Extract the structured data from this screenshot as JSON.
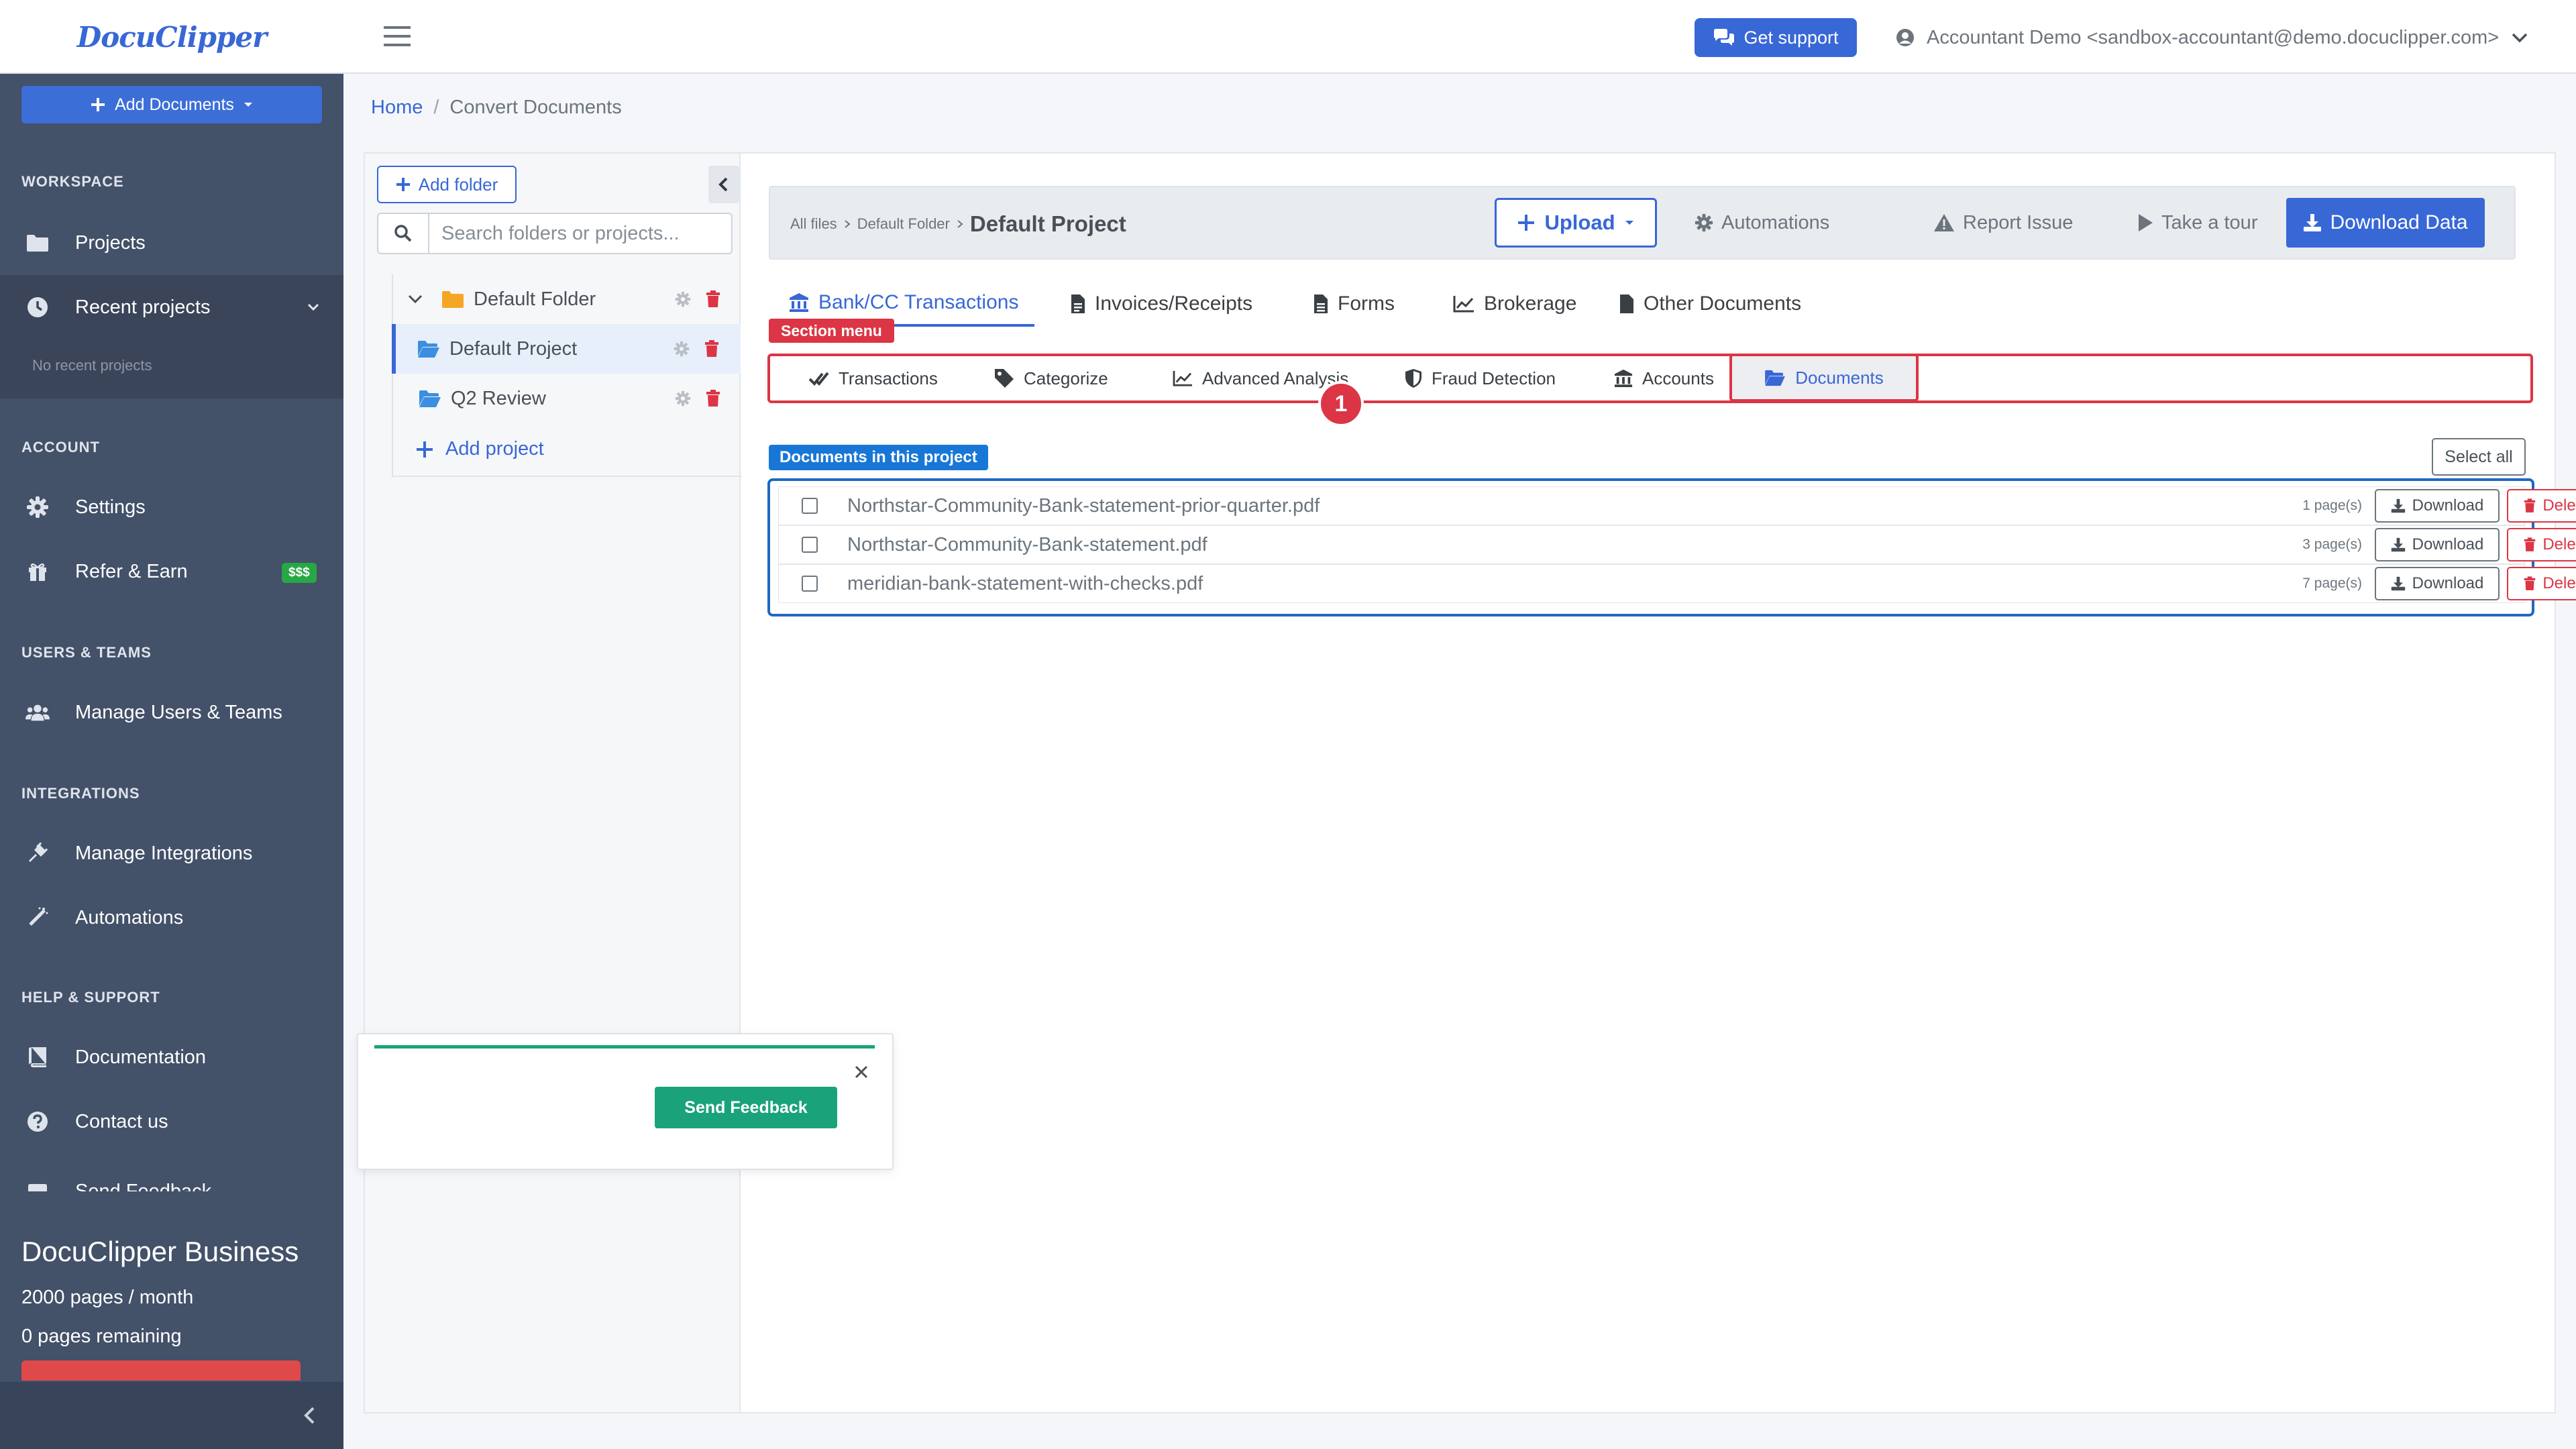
{
  "app": {
    "logo": "DocuClipper"
  },
  "topbar": {
    "support_label": "Get support",
    "user_label": "Accountant Demo <sandbox-accountant@demo.docuclipper.com>"
  },
  "sidebar": {
    "add_documents_label": "Add Documents",
    "sections": {
      "workspace": "WORKSPACE",
      "account": "ACCOUNT",
      "users": "USERS & TEAMS",
      "integrations": "INTEGRATIONS",
      "help": "HELP & SUPPORT"
    },
    "items": {
      "projects": "Projects",
      "recent_projects": "Recent projects",
      "no_recent": "No recent projects",
      "settings": "Settings",
      "refer": "Refer & Earn",
      "refer_badge": "$$$",
      "manage_users": "Manage Users & Teams",
      "manage_integrations": "Manage Integrations",
      "automations": "Automations",
      "documentation": "Documentation",
      "contact": "Contact us",
      "send_feedback": "Send Feedback"
    },
    "plan": {
      "name": "DocuClipper Business",
      "pages": "2000 pages / month",
      "remaining": "0 pages remaining"
    }
  },
  "breadcrumb": {
    "home": "Home",
    "separator": "/",
    "current": "Convert Documents"
  },
  "folders": {
    "add_folder_label": "Add folder",
    "search_placeholder": "Search folders or projects...",
    "tree": [
      {
        "label": "Default Folder",
        "type": "folder"
      },
      {
        "label": "Default Project",
        "type": "project",
        "selected": true
      },
      {
        "label": "Q2 Review",
        "type": "project"
      }
    ],
    "add_project_label": "Add project"
  },
  "project_header": {
    "crumb_all": "All files",
    "crumb_folder": "Default Folder",
    "project_name": "Default Project",
    "upload_label": "Upload",
    "automations_label": "Automations",
    "report_label": "Report Issue",
    "tour_label": "Take a tour",
    "download_data_label": "Download Data"
  },
  "category_tabs": [
    {
      "label": "Bank/CC Transactions",
      "active": true
    },
    {
      "label": "Invoices/Receipts"
    },
    {
      "label": "Forms"
    },
    {
      "label": "Brokerage"
    },
    {
      "label": "Other Documents"
    }
  ],
  "section_menu": {
    "label": "Section menu",
    "step_number": "1",
    "tabs": [
      {
        "label": "Transactions"
      },
      {
        "label": "Categorize"
      },
      {
        "label": "Advanced Analysis"
      },
      {
        "label": "Fraud Detection"
      },
      {
        "label": "Accounts"
      },
      {
        "label": "Documents",
        "active": true
      }
    ]
  },
  "documents": {
    "label": "Documents in this project",
    "select_all_label": "Select all",
    "download_label": "Download",
    "delete_label": "Delete",
    "items": [
      {
        "name": "Northstar-Community-Bank-statement-prior-quarter.pdf",
        "pages": "1 page(s)"
      },
      {
        "name": "Northstar-Community-Bank-statement.pdf",
        "pages": "3 page(s)"
      },
      {
        "name": "meridian-bank-statement-with-checks.pdf",
        "pages": "7 page(s)"
      }
    ]
  },
  "feedback": {
    "send_label": "Send Feedback"
  },
  "colors": {
    "primary": "#3867d6",
    "danger": "#dc3545",
    "success": "#1aa37a",
    "sidebar": "#435169",
    "highlight": "#1f69c1"
  }
}
